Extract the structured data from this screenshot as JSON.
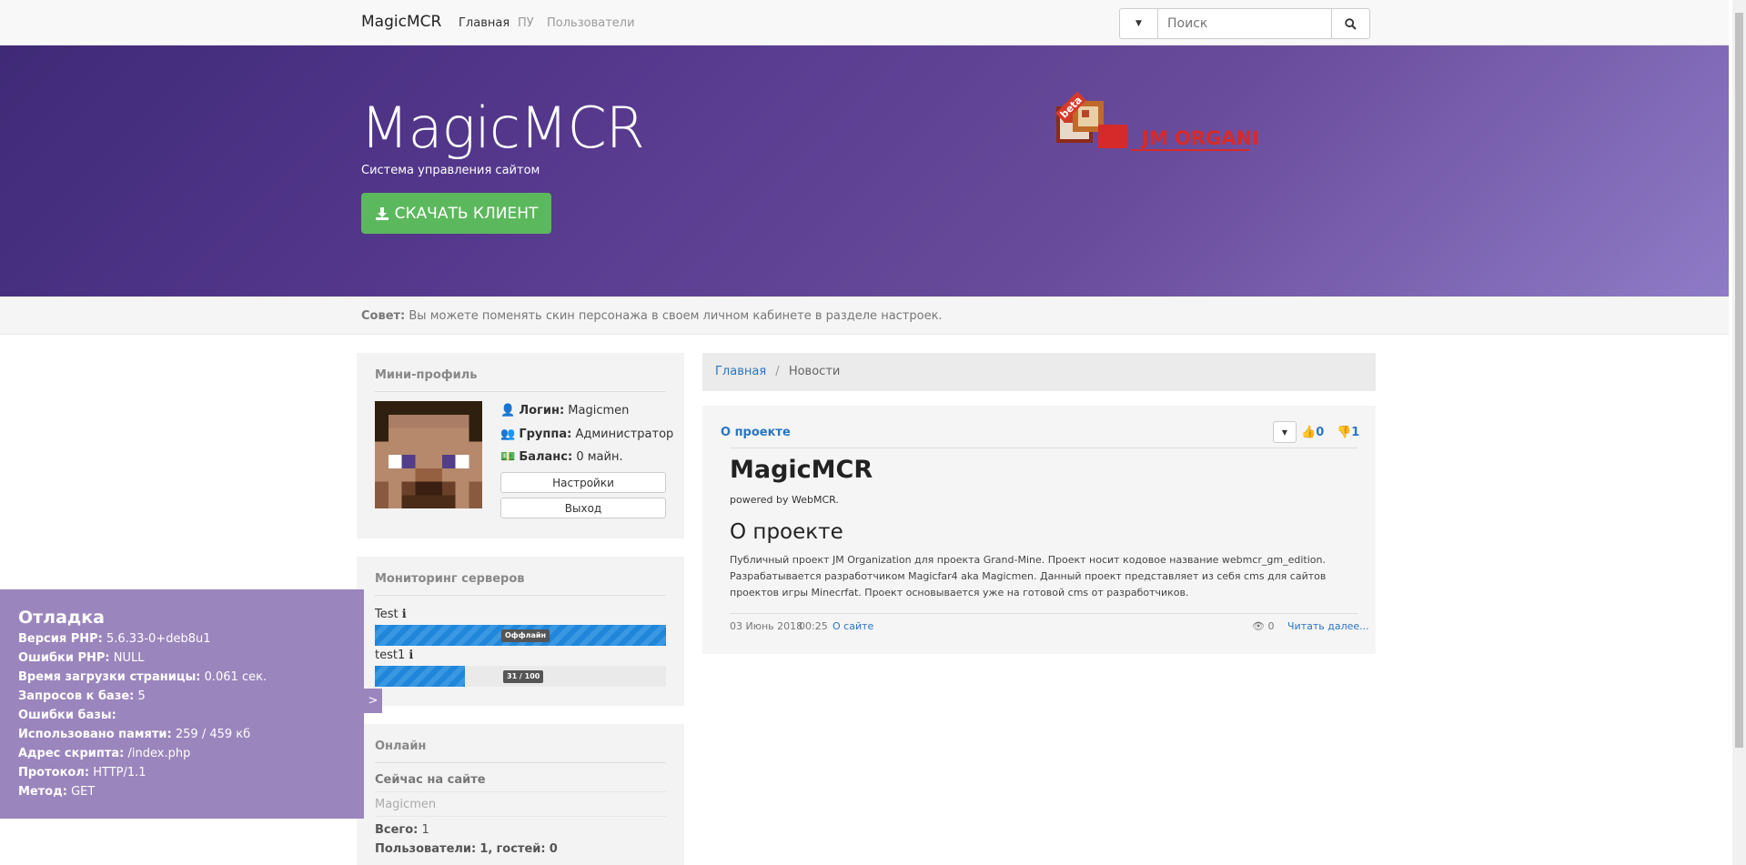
{
  "navbar": {
    "brand": "MagicMCR",
    "links": [
      "Главная",
      "ПУ",
      "Пользователи"
    ],
    "search_placeholder": "Поиск"
  },
  "hero": {
    "title": "MagicMCR",
    "subtitle": "Система управления сайтом",
    "download_label": "СКАЧАТЬ КЛИЕНТ",
    "logo_text": "JM ORGANIZATION",
    "logo_badge": "beta"
  },
  "tip": {
    "prefix": "Совет:",
    "text": "Вы можете поменять скин персонажа в своем личном кабинете в разделе настроек."
  },
  "mini_profile": {
    "title": "Мини-профиль",
    "login_label": "Логин:",
    "login_value": "Magicmen",
    "group_label": "Группа:",
    "group_value": "Администратор",
    "balance_label": "Баланс:",
    "balance_value": "0 майн.",
    "settings_button": "Настройки",
    "logout_button": "Выход"
  },
  "monitoring": {
    "title": "Мониторинг серверов",
    "servers": [
      {
        "name": "Test",
        "label": "Оффлайн",
        "fill": 1.0
      },
      {
        "name": "test1",
        "label": "31 / 100",
        "fill": 0.31
      }
    ]
  },
  "online": {
    "title": "Онлайн",
    "now_label": "Сейчас на сайте",
    "user": "Magicmen",
    "total_label": "Всего:",
    "total_value": "1",
    "users_label": "Пользователи:",
    "users_value": "1,",
    "guests_label": "гостей:",
    "guests_value": "0"
  },
  "breadcrumb": {
    "home": "Главная",
    "separator": "/",
    "current": "Новости"
  },
  "news": {
    "category": "О проекте",
    "likes": "0",
    "dislikes": "1",
    "heading": "MagicMCR",
    "powered": "powered by WebMCR.",
    "subheading": "О проекте",
    "body": "Публичный проект JM Organization для проекта Grand-Mine. Проект носит кодовое название webmcr_gm_edition. Разрабатывается разработчиком Magicfar4 aka Magicmen. Данный проект представляет из себя cms для сайтов проектов игры Minecrfat. Проект основывается уже на готовой cms от разработчиков.",
    "date": "03 Июнь 2018",
    "time": "00:25",
    "section_link": "О сайте",
    "views": "0",
    "read_more": "Читать далее..."
  },
  "debug": {
    "title": "Отладка",
    "rows": [
      {
        "label": "Версия PHP:",
        "value": "5.6.33-0+deb8u1"
      },
      {
        "label": "Ошибки PHP:",
        "value": "NULL"
      },
      {
        "label": "Время загрузки страницы:",
        "value": "0.061 сек."
      },
      {
        "label": "Запросов к базе:",
        "value": "5"
      },
      {
        "label": "Ошибки базы:",
        "value": ""
      },
      {
        "label": "Использовано памяти:",
        "value": "259 / 459 кб"
      },
      {
        "label": "Адрес скрипта:",
        "value": "/index.php"
      },
      {
        "label": "Протокол:",
        "value": "HTTP/1.1"
      },
      {
        "label": "Метод:",
        "value": "GET"
      }
    ],
    "toggle": ">"
  },
  "colors": {
    "accent": "#2a75c4",
    "success": "#5cb85c",
    "hero_start": "#3f2a78",
    "hero_end": "#8e7bc6",
    "debug_bg": "#9b85bd",
    "progress": "#1f86d9"
  }
}
